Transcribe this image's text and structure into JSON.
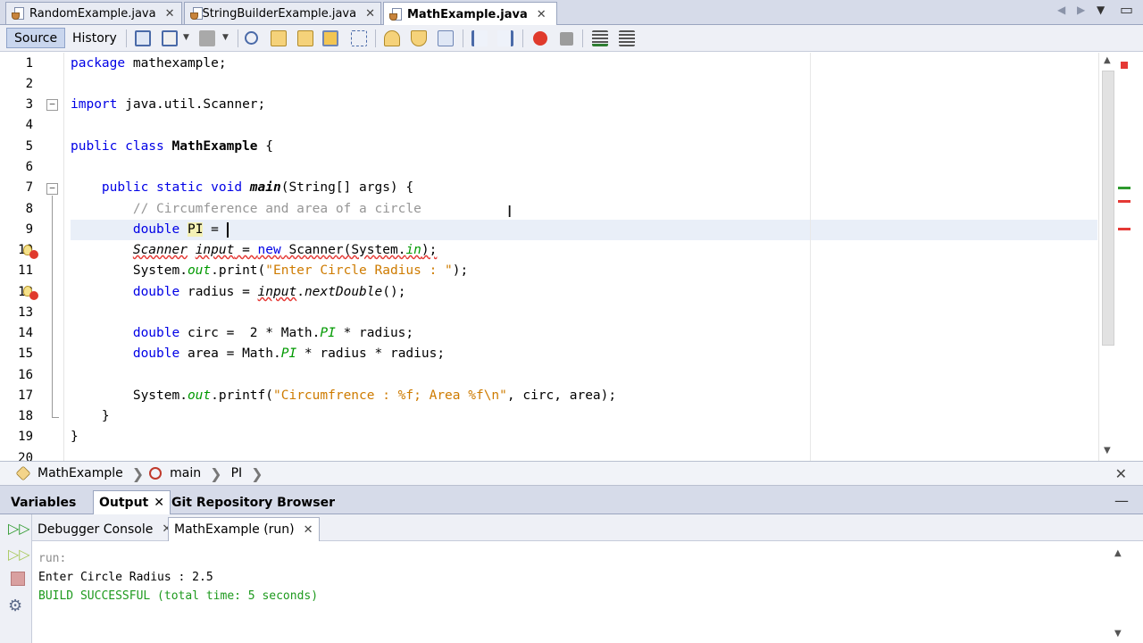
{
  "file_tabs": [
    {
      "label": "RandomExample.java",
      "active": false
    },
    {
      "label": "StringBuilderExample.java",
      "active": false
    },
    {
      "label": "MathExample.java",
      "active": true
    }
  ],
  "toolbar": {
    "source_label": "Source",
    "history_label": "History",
    "icons": [
      "last-edit-icon",
      "back-icon",
      "forward-icon",
      "find-icon",
      "find-previous-icon",
      "find-next-icon",
      "toggle-highlight-icon",
      "toggle-rect-selection-icon",
      "previous-bookmark-icon",
      "next-bookmark-icon",
      "toggle-bookmark-icon",
      "shift-left-icon",
      "shift-right-icon",
      "start-macro-icon",
      "stop-macro-icon",
      "comment-icon",
      "uncomment-icon"
    ]
  },
  "editor": {
    "line_numbers": [
      "1",
      "2",
      "3",
      "4",
      "5",
      "6",
      "7",
      "8",
      "9",
      "10",
      "11",
      "12",
      "13",
      "14",
      "15",
      "16",
      "17",
      "18",
      "19",
      "20"
    ],
    "code": {
      "l1_kw": "package",
      "l1_rest": " mathexample;",
      "l3_kw": "import",
      "l3_rest": " java.util.Scanner;",
      "l5_kw": "public class",
      "l5_cls": "MathExample",
      "l5_rest": " {",
      "l7_kw": "public static void",
      "l7_mth": "main",
      "l7_rest": "(String[] args) {",
      "l8_cmt": "// Circumference and area of a circle",
      "l9_kw": "double",
      "l9_var": "PI",
      "l9_rest": " = ",
      "l10_a": "Scanner",
      "l10_b": "input",
      "l10_c": " = ",
      "l10_kw": "new",
      "l10_d": " Scanner(System.",
      "l10_fld": "in",
      "l10_e": ");",
      "l11_a": "System.",
      "l11_fld": "out",
      "l11_b": ".print(",
      "l11_str": "\"Enter Circle Radius : \"",
      "l11_c": ");",
      "l12_kw": "double",
      "l12_a": " radius = ",
      "l12_err": "input",
      "l12_b": ".",
      "l12_mth": "nextDouble",
      "l12_c": "();",
      "l14_kw": "double",
      "l14_a": " circ =  2 * Math.",
      "l14_fld": "PI",
      "l14_b": " * radius;",
      "l15_kw": "double",
      "l15_a": " area = Math.",
      "l15_fld": "PI",
      "l15_b": " * radius * radius;",
      "l17_a": "System.",
      "l17_fld": "out",
      "l17_b": ".printf(",
      "l17_str": "\"Circumfrence : %f; Area %f\\n\"",
      "l17_c": ", circ, area);",
      "l18": "}",
      "l19": "}"
    }
  },
  "breadcrumb": {
    "items": [
      "MathExample",
      "main",
      "PI"
    ]
  },
  "bottom_panel": {
    "tabs": [
      "Variables",
      "Output",
      "Git Repository Browser"
    ],
    "active_tab": "Output",
    "output_tabs": [
      "Debugger Console",
      "MathExample (run)"
    ],
    "active_output_tab": "MathExample (run)",
    "output_lines": [
      {
        "text": "run:",
        "color": "#8c8c8c"
      },
      {
        "text": "Enter Circle Radius : 2.5",
        "color": "#000000"
      },
      {
        "text": "BUILD SUCCESSFUL (total time: 5 seconds)",
        "color": "#1e9a1e"
      }
    ]
  },
  "colors": {
    "keyword": "#0000e6",
    "comment": "#969696",
    "string": "#ce7b00",
    "static_field": "#009900",
    "current_line": "#e9eff8",
    "success": "#1e9a1e"
  }
}
